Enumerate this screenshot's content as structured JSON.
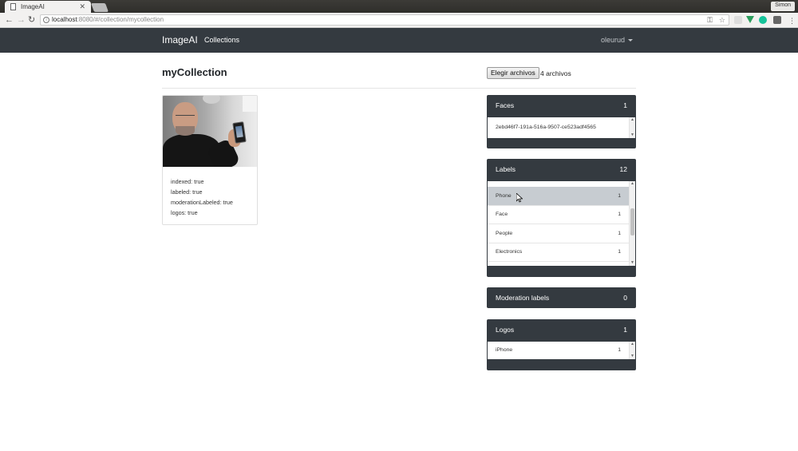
{
  "browser": {
    "tab_title": "ImageAI",
    "user_name": "Simon",
    "url_host": "localhost",
    "url_path": ":8080/#/collection/mycollection"
  },
  "navbar": {
    "brand": "ImageAI",
    "collections": "Collections",
    "user": "oleurud"
  },
  "main": {
    "title": "myCollection",
    "file_button": "Elegir archivos",
    "file_count": "4 archivos"
  },
  "image_card": {
    "properties": [
      "indexed: true",
      "labeled: true",
      "moderationLabeled: true",
      "logos: true"
    ]
  },
  "panels": {
    "faces": {
      "title": "Faces",
      "count": "1",
      "items": [
        {
          "label": "2ebd46f7-191a-516a-9507-ce523adf4565",
          "count": ""
        }
      ]
    },
    "labels": {
      "title": "Labels",
      "count": "12",
      "items": [
        {
          "label": "Phone",
          "count": "1"
        },
        {
          "label": "Face",
          "count": "1"
        },
        {
          "label": "People",
          "count": "1"
        },
        {
          "label": "Electronics",
          "count": "1"
        }
      ]
    },
    "moderation": {
      "title": "Moderation labels",
      "count": "0"
    },
    "logos": {
      "title": "Logos",
      "count": "1",
      "items": [
        {
          "label": "iPhone",
          "count": "1"
        }
      ]
    }
  },
  "colors": {
    "navbar": "#343a40",
    "active_row": "#c7ccd1"
  }
}
